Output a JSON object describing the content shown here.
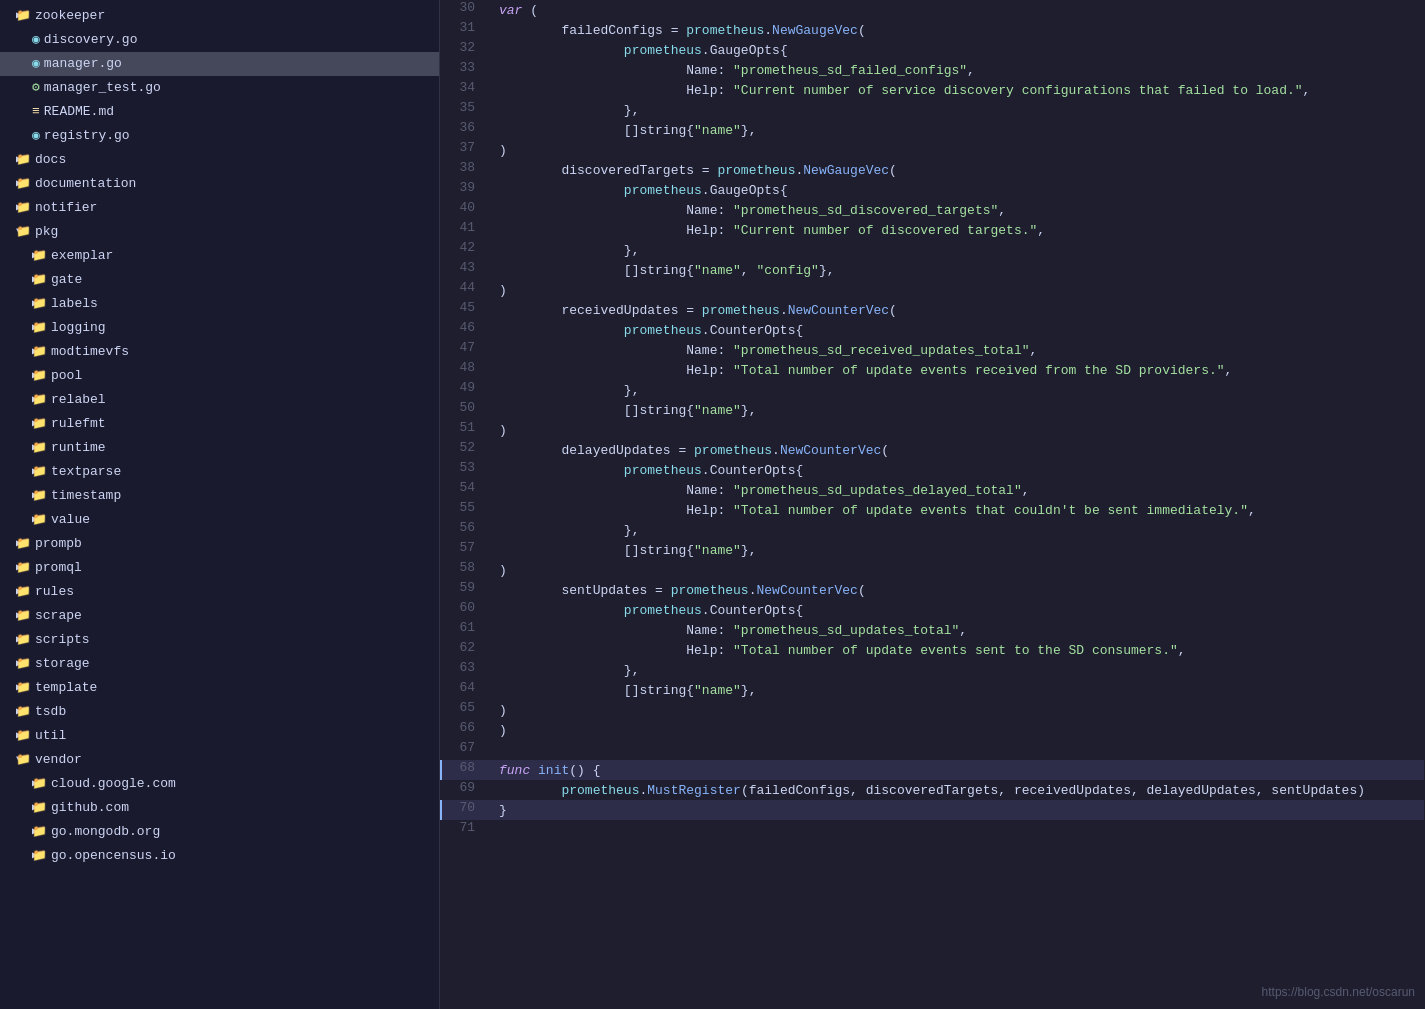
{
  "sidebar": {
    "items": [
      {
        "id": "zookeeper",
        "label": "zookeeper",
        "type": "folder",
        "indent": 1,
        "expanded": false,
        "arrow": "▶"
      },
      {
        "id": "discovery.go",
        "label": "discovery.go",
        "type": "file-go",
        "indent": 2,
        "expanded": false,
        "arrow": ""
      },
      {
        "id": "manager.go",
        "label": "manager.go",
        "type": "file-go",
        "indent": 2,
        "expanded": false,
        "arrow": "",
        "active": true
      },
      {
        "id": "manager_test.go",
        "label": "manager_test.go",
        "type": "file-go-test",
        "indent": 2,
        "expanded": false,
        "arrow": ""
      },
      {
        "id": "README.md",
        "label": "README.md",
        "type": "file-md",
        "indent": 2,
        "expanded": false,
        "arrow": ""
      },
      {
        "id": "registry.go",
        "label": "registry.go",
        "type": "file-go",
        "indent": 2,
        "expanded": false,
        "arrow": ""
      },
      {
        "id": "docs",
        "label": "docs",
        "type": "folder",
        "indent": 1,
        "expanded": false,
        "arrow": "▶"
      },
      {
        "id": "documentation",
        "label": "documentation",
        "type": "folder",
        "indent": 1,
        "expanded": false,
        "arrow": "▶"
      },
      {
        "id": "notifier",
        "label": "notifier",
        "type": "folder",
        "indent": 1,
        "expanded": false,
        "arrow": "▶"
      },
      {
        "id": "pkg",
        "label": "pkg",
        "type": "folder",
        "indent": 1,
        "expanded": true,
        "arrow": "▼"
      },
      {
        "id": "exemplar",
        "label": "exemplar",
        "type": "folder",
        "indent": 2,
        "expanded": false,
        "arrow": "▶"
      },
      {
        "id": "gate",
        "label": "gate",
        "type": "folder",
        "indent": 2,
        "expanded": false,
        "arrow": "▶"
      },
      {
        "id": "labels",
        "label": "labels",
        "type": "folder",
        "indent": 2,
        "expanded": false,
        "arrow": "▶"
      },
      {
        "id": "logging",
        "label": "logging",
        "type": "folder",
        "indent": 2,
        "expanded": false,
        "arrow": "▶"
      },
      {
        "id": "modtimevfs",
        "label": "modtimevfs",
        "type": "folder",
        "indent": 2,
        "expanded": false,
        "arrow": "▶"
      },
      {
        "id": "pool",
        "label": "pool",
        "type": "folder",
        "indent": 2,
        "expanded": false,
        "arrow": "▶"
      },
      {
        "id": "relabel",
        "label": "relabel",
        "type": "folder",
        "indent": 2,
        "expanded": false,
        "arrow": "▶"
      },
      {
        "id": "rulefmt",
        "label": "rulefmt",
        "type": "folder",
        "indent": 2,
        "expanded": false,
        "arrow": "▶"
      },
      {
        "id": "runtime",
        "label": "runtime",
        "type": "folder",
        "indent": 2,
        "expanded": false,
        "arrow": "▶"
      },
      {
        "id": "textparse",
        "label": "textparse",
        "type": "folder",
        "indent": 2,
        "expanded": false,
        "arrow": "▶"
      },
      {
        "id": "timestamp",
        "label": "timestamp",
        "type": "folder",
        "indent": 2,
        "expanded": false,
        "arrow": "▶"
      },
      {
        "id": "value",
        "label": "value",
        "type": "folder",
        "indent": 2,
        "expanded": false,
        "arrow": "▶"
      },
      {
        "id": "prompb",
        "label": "prompb",
        "type": "folder",
        "indent": 1,
        "expanded": false,
        "arrow": "▶"
      },
      {
        "id": "promql",
        "label": "promql",
        "type": "folder",
        "indent": 1,
        "expanded": false,
        "arrow": "▶"
      },
      {
        "id": "rules",
        "label": "rules",
        "type": "folder",
        "indent": 1,
        "expanded": false,
        "arrow": "▶"
      },
      {
        "id": "scrape",
        "label": "scrape",
        "type": "folder",
        "indent": 1,
        "expanded": false,
        "arrow": "▶"
      },
      {
        "id": "scripts",
        "label": "scripts",
        "type": "folder",
        "indent": 1,
        "expanded": false,
        "arrow": "▶"
      },
      {
        "id": "storage",
        "label": "storage",
        "type": "folder",
        "indent": 1,
        "expanded": false,
        "arrow": "▶"
      },
      {
        "id": "template",
        "label": "template",
        "type": "folder",
        "indent": 1,
        "expanded": false,
        "arrow": "▶"
      },
      {
        "id": "tsdb",
        "label": "tsdb",
        "type": "folder",
        "indent": 1,
        "expanded": false,
        "arrow": "▶"
      },
      {
        "id": "util",
        "label": "util",
        "type": "folder",
        "indent": 1,
        "expanded": false,
        "arrow": "▶"
      },
      {
        "id": "vendor",
        "label": "vendor",
        "type": "folder-vendor",
        "indent": 1,
        "expanded": true,
        "arrow": "▼"
      },
      {
        "id": "cloud.google.com",
        "label": "cloud.google.com",
        "type": "folder",
        "indent": 2,
        "expanded": false,
        "arrow": "▶"
      },
      {
        "id": "github.com",
        "label": "github.com",
        "type": "folder",
        "indent": 2,
        "expanded": false,
        "arrow": "▶"
      },
      {
        "id": "go.mongodb.org",
        "label": "go.mongodb.org",
        "type": "folder",
        "indent": 2,
        "expanded": false,
        "arrow": "▶"
      },
      {
        "id": "go.opencensus.io",
        "label": "go.opencensus.io",
        "type": "folder",
        "indent": 2,
        "expanded": false,
        "arrow": "▶"
      }
    ]
  },
  "code": {
    "lines": [
      {
        "num": 30,
        "content": "var ("
      },
      {
        "num": 31,
        "content": "\tfailedConfigs = prometheus.NewGaugeVec("
      },
      {
        "num": 32,
        "content": "\t\tprometheus.GaugeOpts{"
      },
      {
        "num": 33,
        "content": "\t\t\tName: \"prometheus_sd_failed_configs\","
      },
      {
        "num": 34,
        "content": "\t\t\tHelp: \"Current number of service discovery configurations that failed to load.\","
      },
      {
        "num": 35,
        "content": "\t\t},"
      },
      {
        "num": 36,
        "content": "\t\t[]string{\"name\"},"
      },
      {
        "num": 37,
        "content": "\t)"
      },
      {
        "num": 38,
        "content": "\tdiscoveredTargets = prometheus.NewGaugeVec("
      },
      {
        "num": 39,
        "content": "\t\tprometheus.GaugeOpts{"
      },
      {
        "num": 40,
        "content": "\t\t\tName: \"prometheus_sd_discovered_targets\","
      },
      {
        "num": 41,
        "content": "\t\t\tHelp: \"Current number of discovered targets.\","
      },
      {
        "num": 42,
        "content": "\t\t},"
      },
      {
        "num": 43,
        "content": "\t\t[]string{\"name\", \"config\"},"
      },
      {
        "num": 44,
        "content": "\t)"
      },
      {
        "num": 45,
        "content": "\treceivedUpdates = prometheus.NewCounterVec("
      },
      {
        "num": 46,
        "content": "\t\tprometheus.CounterOpts{"
      },
      {
        "num": 47,
        "content": "\t\t\tName: \"prometheus_sd_received_updates_total\","
      },
      {
        "num": 48,
        "content": "\t\t\tHelp: \"Total number of update events received from the SD providers.\","
      },
      {
        "num": 49,
        "content": "\t\t},"
      },
      {
        "num": 50,
        "content": "\t\t[]string{\"name\"},"
      },
      {
        "num": 51,
        "content": "\t)"
      },
      {
        "num": 52,
        "content": "\tdelayedUpdates = prometheus.NewCounterVec("
      },
      {
        "num": 53,
        "content": "\t\tprometheus.CounterOpts{"
      },
      {
        "num": 54,
        "content": "\t\t\tName: \"prometheus_sd_updates_delayed_total\","
      },
      {
        "num": 55,
        "content": "\t\t\tHelp: \"Total number of update events that couldn't be sent immediately.\","
      },
      {
        "num": 56,
        "content": "\t\t},"
      },
      {
        "num": 57,
        "content": "\t\t[]string{\"name\"},"
      },
      {
        "num": 58,
        "content": "\t)"
      },
      {
        "num": 59,
        "content": "\tsentUpdates = prometheus.NewCounterVec("
      },
      {
        "num": 60,
        "content": "\t\tprometheus.CounterOpts{"
      },
      {
        "num": 61,
        "content": "\t\t\tName: \"prometheus_sd_updates_total\","
      },
      {
        "num": 62,
        "content": "\t\t\tHelp: \"Total number of update events sent to the SD consumers.\","
      },
      {
        "num": 63,
        "content": "\t\t},"
      },
      {
        "num": 64,
        "content": "\t\t[]string{\"name\"},"
      },
      {
        "num": 65,
        "content": "\t)"
      },
      {
        "num": 66,
        "content": ")"
      },
      {
        "num": 67,
        "content": ""
      },
      {
        "num": 68,
        "content": "func init() {",
        "highlight": true
      },
      {
        "num": 69,
        "content": "\tprometheus.MustRegister(failedConfigs, discoveredTargets, receivedUpdates, delayedUpdates, sentUpdates)"
      },
      {
        "num": 70,
        "content": "}",
        "highlight": true
      },
      {
        "num": 71,
        "content": ""
      }
    ],
    "watermark": "https://blog.csdn.net/oscarun"
  }
}
